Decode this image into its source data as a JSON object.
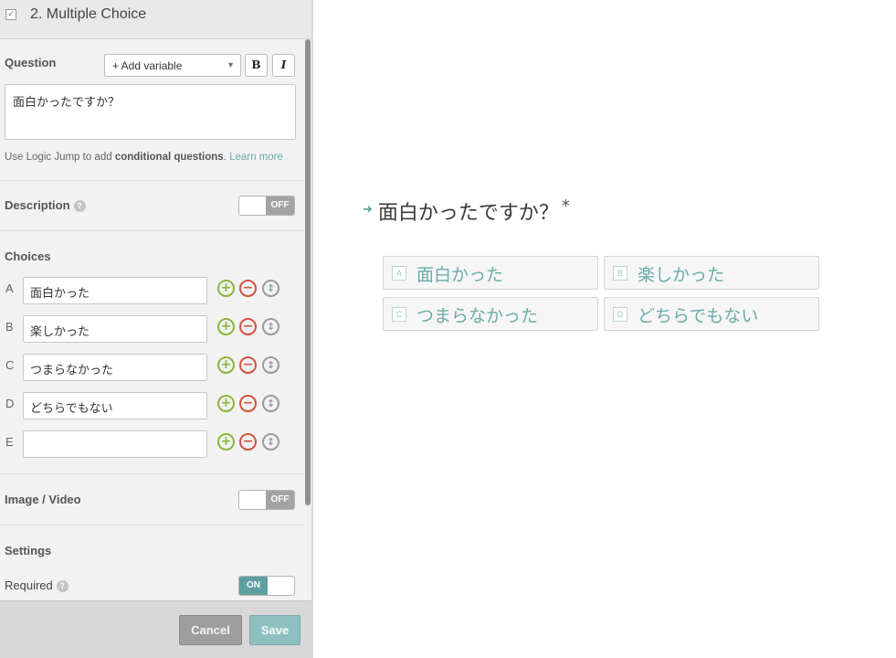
{
  "header": {
    "title": "2. Multiple Choice",
    "icon": "check-icon"
  },
  "question": {
    "label": "Question",
    "add_variable": "+ Add variable",
    "bold_label": "B",
    "italic_label": "I",
    "text": "面白かったですか？",
    "logic_prefix": "Use Logic Jump to add ",
    "logic_bold": "conditional questions",
    "logic_suffix": ".",
    "learn_more": "Learn more"
  },
  "description": {
    "label": "Description",
    "toggle_label": "OFF",
    "enabled": false
  },
  "choices": {
    "label": "Choices",
    "items": [
      {
        "letter": "A",
        "value": "面白かった"
      },
      {
        "letter": "B",
        "value": "楽しかった"
      },
      {
        "letter": "C",
        "value": "つまらなかった"
      },
      {
        "letter": "D",
        "value": "どちらでもない"
      },
      {
        "letter": "E",
        "value": ""
      }
    ]
  },
  "image_video": {
    "label": "Image / Video",
    "toggle_label": "OFF",
    "enabled": false
  },
  "settings": {
    "label": "Settings",
    "required_label": "Required",
    "required_toggle": "ON",
    "required": true
  },
  "footer": {
    "cancel": "Cancel",
    "save": "Save"
  },
  "preview": {
    "question": "面白かったですか？",
    "required_mark": "*",
    "choices": [
      {
        "key": "A",
        "label": "面白かった"
      },
      {
        "key": "B",
        "label": "楽しかった"
      },
      {
        "key": "C",
        "label": "つまらなかった"
      },
      {
        "key": "D",
        "label": "どちらでもない"
      }
    ]
  },
  "colors": {
    "accent": "#5f9ea0",
    "add": "#8ab63a",
    "remove": "#d2523f",
    "panel_bg": "#f2f2f2"
  }
}
